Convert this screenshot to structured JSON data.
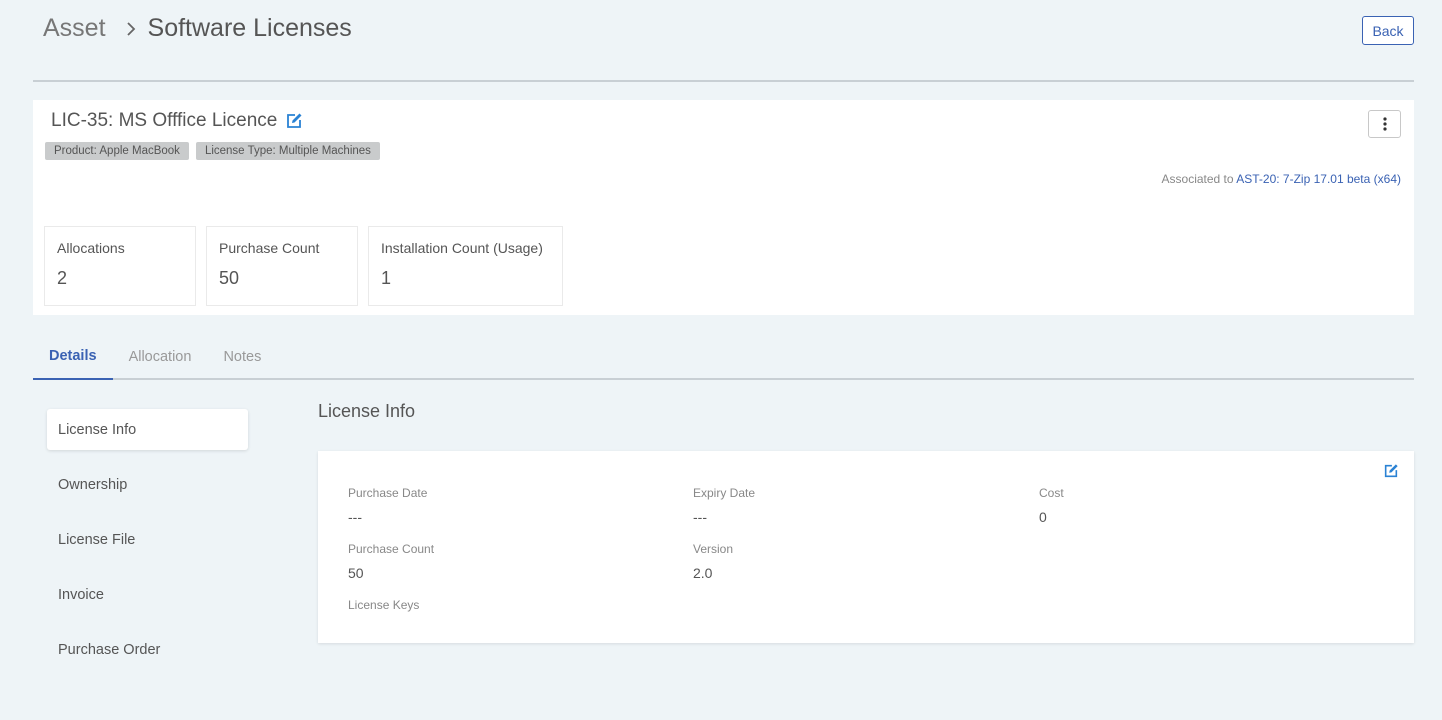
{
  "breadcrumb": {
    "root": "Asset",
    "current": "Software Licenses"
  },
  "header": {
    "back_label": "Back"
  },
  "license": {
    "title": "LIC-35: MS Offfice Licence",
    "tags": [
      "Product: Apple MacBook",
      "License Type: Multiple Machines"
    ],
    "associated_prefix": "Associated to",
    "associated_link": "AST-20: 7-Zip 17.01 beta (x64)"
  },
  "stats": [
    {
      "label": "Allocations",
      "value": "2"
    },
    {
      "label": "Purchase Count",
      "value": "50"
    },
    {
      "label": "Installation Count (Usage)",
      "value": "1"
    }
  ],
  "tabs": [
    "Details",
    "Allocation",
    "Notes"
  ],
  "side_nav": [
    "License Info",
    "Ownership",
    "License File",
    "Invoice",
    "Purchase Order"
  ],
  "section": {
    "title": "License Info",
    "fields": {
      "purchase_date": {
        "label": "Purchase Date",
        "value": "---"
      },
      "expiry_date": {
        "label": "Expiry Date",
        "value": "---"
      },
      "cost": {
        "label": "Cost",
        "value": "0"
      },
      "purchase_count": {
        "label": "Purchase Count",
        "value": "50"
      },
      "version": {
        "label": "Version",
        "value": "2.0"
      },
      "license_keys": {
        "label": "License Keys",
        "value": ""
      }
    }
  },
  "colors": {
    "accent": "#3a62b3",
    "edit_icon": "#2a82d4"
  }
}
